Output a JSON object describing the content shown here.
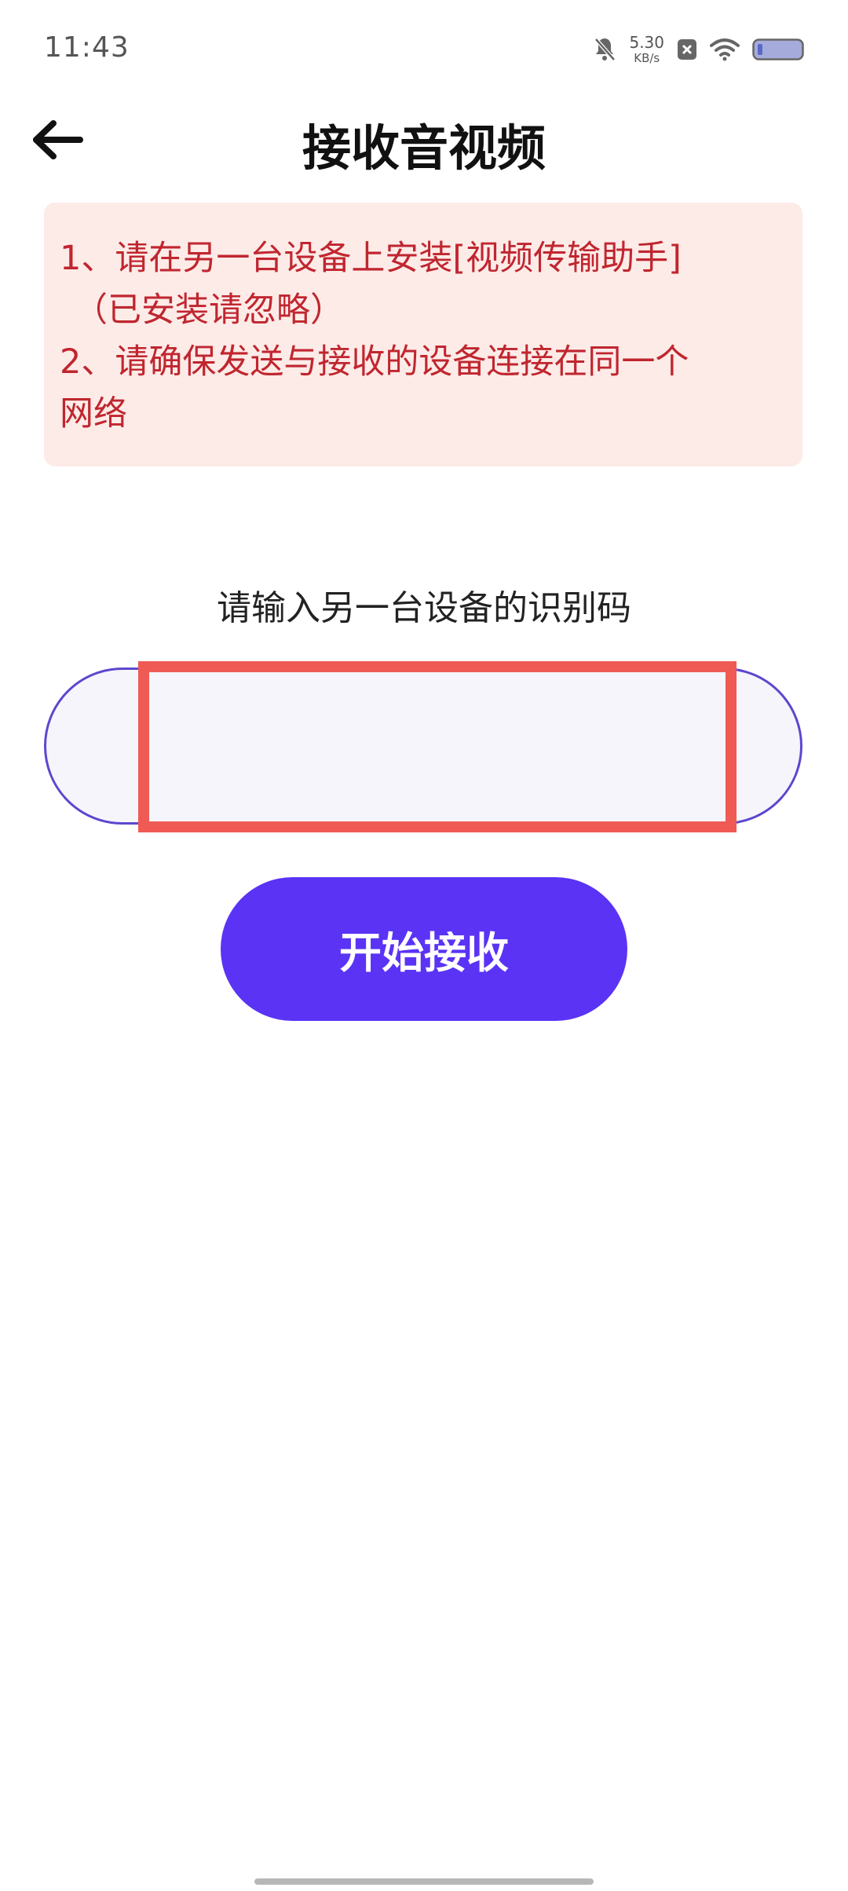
{
  "status_bar": {
    "time": "11:43",
    "net_speed_value": "5.30",
    "net_speed_unit": "KB/s",
    "icons": [
      "bell-off-icon",
      "close-box-icon",
      "wifi-icon",
      "battery-icon"
    ]
  },
  "header": {
    "title": "接收音视频",
    "back_icon": "arrow-left-icon"
  },
  "notice": {
    "line1": "1、请在另一台设备上安装[视频传输助手]",
    "line2": "（已安装请忽略）",
    "line3": "2、请确保发送与接收的设备连接在同一个",
    "line4": "网络"
  },
  "form": {
    "prompt": "请输入另一台设备的识别码",
    "code_value": "",
    "start_label": "开始接收"
  },
  "colors": {
    "accent": "#5a33f5",
    "notice_bg": "#fdebe8",
    "notice_text": "#c0262f",
    "highlight_border": "#ef5a55"
  }
}
